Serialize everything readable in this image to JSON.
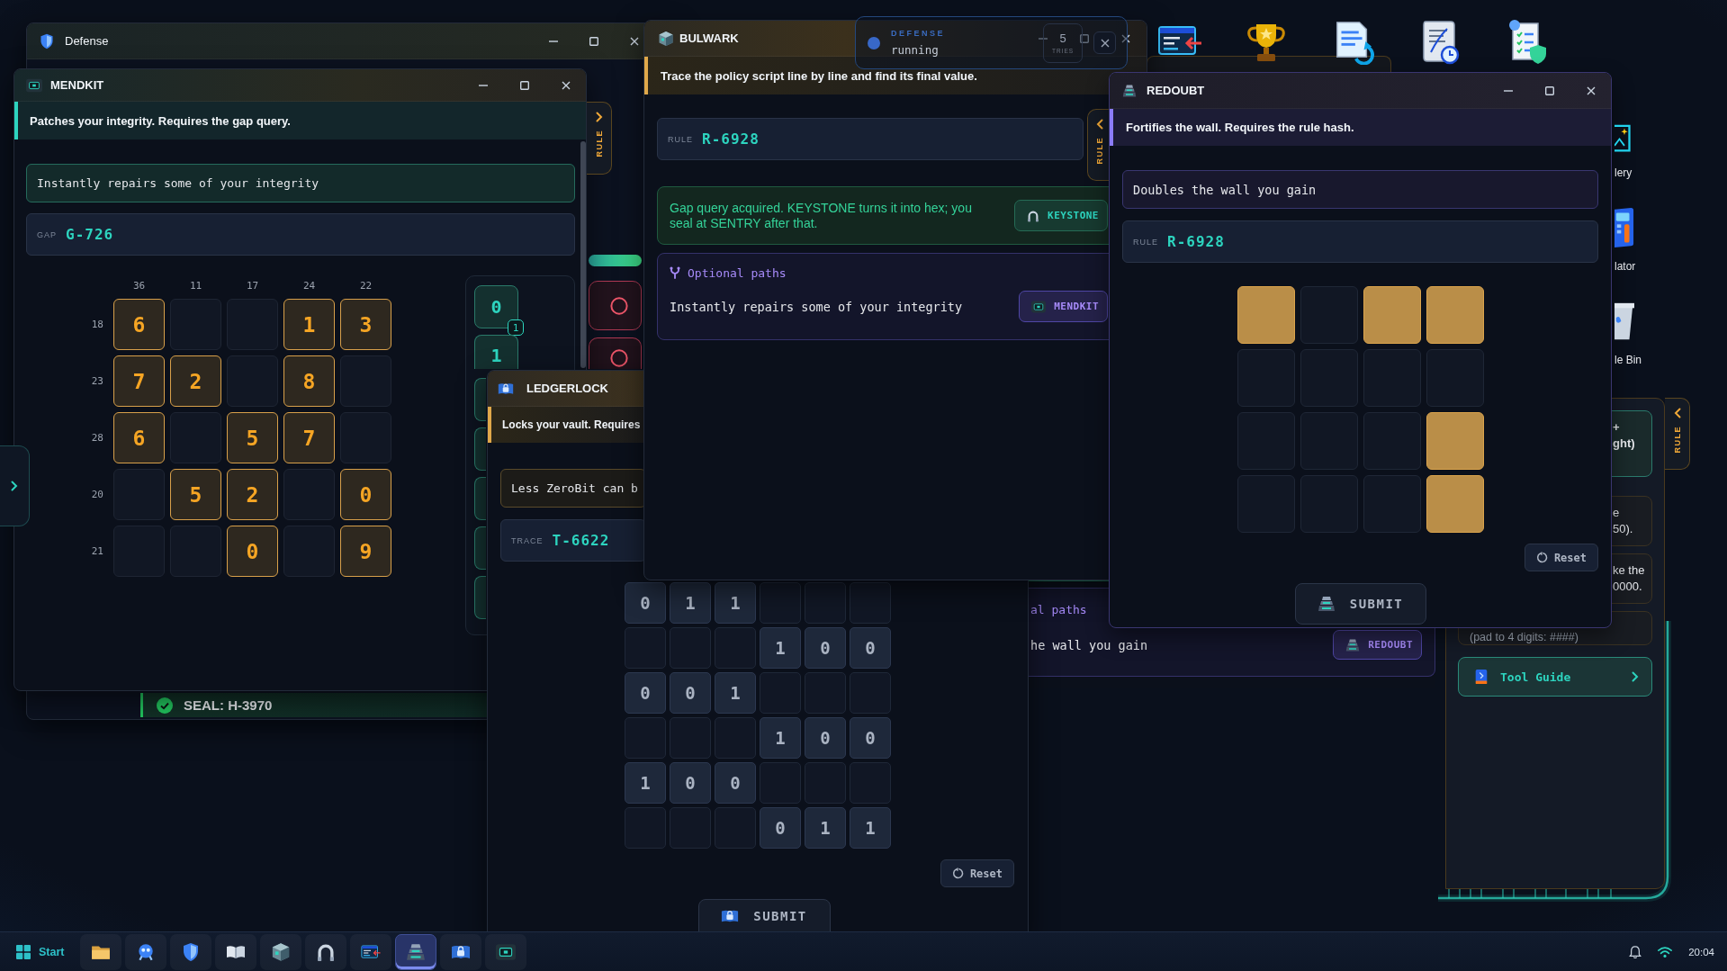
{
  "desktop": {
    "top_icons": [
      {
        "kind": "code"
      },
      {
        "kind": "trophy"
      },
      {
        "kind": "document"
      },
      {
        "kind": "scroll"
      },
      {
        "kind": "checklist"
      }
    ],
    "side_icons": [
      {
        "kind": "gallery",
        "label": "lery"
      },
      {
        "kind": "calculator",
        "label": "lator"
      },
      {
        "kind": "bin",
        "label": "le Bin"
      }
    ]
  },
  "defense": {
    "title": "Defense",
    "status_tiles": [
      {
        "kind": "ring"
      },
      {
        "kind": "ring"
      }
    ],
    "seal": "SEAL: H-3970"
  },
  "mendkit": {
    "title": "MENDKIT",
    "description": "Patches your integrity. Requires the gap query.",
    "effect": "Instantly repairs some of your integrity",
    "field": {
      "label": "GAP",
      "value": "G-726"
    },
    "grid": {
      "columns": [
        "36",
        "11",
        "17",
        "24",
        "22"
      ],
      "rows": [
        {
          "label": "18",
          "cells": [
            {
              "filled": true,
              "value": "6"
            },
            {
              "filled": false
            },
            {
              "filled": false
            },
            {
              "filled": true,
              "value": "1"
            },
            {
              "filled": true,
              "value": "3"
            }
          ]
        },
        {
          "label": "23",
          "cells": [
            {
              "filled": true,
              "value": "7"
            },
            {
              "filled": true,
              "value": "2"
            },
            {
              "filled": false
            },
            {
              "filled": true,
              "value": "8"
            },
            {
              "filled": false
            }
          ]
        },
        {
          "label": "28",
          "cells": [
            {
              "filled": true,
              "value": "6"
            },
            {
              "filled": false
            },
            {
              "filled": true,
              "value": "5"
            },
            {
              "filled": true,
              "value": "7"
            },
            {
              "filled": false
            }
          ]
        },
        {
          "label": "20",
          "cells": [
            {
              "filled": false
            },
            {
              "filled": true,
              "value": "5"
            },
            {
              "filled": true,
              "value": "2"
            },
            {
              "filled": false
            },
            {
              "filled": true,
              "value": "0"
            }
          ]
        },
        {
          "label": "21",
          "cells": [
            {
              "filled": false
            },
            {
              "filled": false
            },
            {
              "filled": true,
              "value": "0"
            },
            {
              "filled": false
            },
            {
              "filled": true,
              "value": "9"
            }
          ]
        }
      ]
    },
    "tiles": [
      {
        "kind": "number",
        "value": "0",
        "badge": "1"
      },
      {
        "kind": "number",
        "value": "1"
      },
      {
        "kind": "blank"
      },
      {
        "kind": "blank"
      },
      {
        "kind": "blank"
      },
      {
        "kind": "blank"
      },
      {
        "kind": "blank"
      }
    ],
    "side_tab": "RULE"
  },
  "ledgerlock": {
    "title": "LEDGERLOCK",
    "description": "Locks your vault. Requires",
    "effect": "Less ZeroBit can b",
    "field": {
      "label": "TRACE",
      "value": "T-6622"
    },
    "grid": [
      [
        {
          "filled": true,
          "value": "0"
        },
        {
          "filled": true,
          "value": "1"
        },
        {
          "filled": true,
          "value": "1"
        },
        {
          "filled": false
        },
        {
          "filled": false
        },
        {
          "filled": false
        }
      ],
      [
        {
          "filled": false
        },
        {
          "filled": false
        },
        {
          "filled": false
        },
        {
          "filled": true,
          "value": "1"
        },
        {
          "filled": true,
          "value": "0"
        },
        {
          "filled": true,
          "value": "0"
        }
      ],
      [
        {
          "filled": true,
          "value": "0"
        },
        {
          "filled": true,
          "value": "0"
        },
        {
          "filled": true,
          "value": "1"
        },
        {
          "filled": false
        },
        {
          "filled": false
        },
        {
          "filled": false
        }
      ],
      [
        {
          "filled": false
        },
        {
          "filled": false
        },
        {
          "filled": false
        },
        {
          "filled": true,
          "value": "1"
        },
        {
          "filled": true,
          "value": "0"
        },
        {
          "filled": true,
          "value": "0"
        }
      ],
      [
        {
          "filled": true,
          "value": "1"
        },
        {
          "filled": true,
          "value": "0"
        },
        {
          "filled": true,
          "value": "0"
        },
        {
          "filled": false
        },
        {
          "filled": false
        },
        {
          "filled": false
        }
      ],
      [
        {
          "filled": false
        },
        {
          "filled": false
        },
        {
          "filled": false
        },
        {
          "filled": true,
          "value": "0"
        },
        {
          "filled": true,
          "value": "1"
        },
        {
          "filled": true,
          "value": "1"
        }
      ]
    ],
    "reset": "Reset",
    "submit": "SUBMIT"
  },
  "bulwark": {
    "title": "BULWARK",
    "description": "Trace the policy script line by line and find its final value.",
    "field": {
      "label": "RULE",
      "value": "R-6928"
    },
    "side_tab": "RULE",
    "message": {
      "text": "Gap query acquired. KEYSTONE turns it into hex; you seal at SENTRY after that.",
      "button": "KEYSTONE"
    },
    "optional": {
      "heading": "Optional paths",
      "effect": "Instantly repairs some of your integrity",
      "button": "MENDKIT"
    }
  },
  "status_pill": {
    "label": "DEFENSE",
    "state": "running",
    "tries": "5",
    "tries_label": "TRIES"
  },
  "background_window": {
    "heading": "al paths",
    "effect": "he wall you gain",
    "button": "REDOUBT"
  },
  "redoubt": {
    "title": "REDOUBT",
    "description": "Fortifies the wall. Requires the rule hash.",
    "effect": "Doubles the wall you gain",
    "field": {
      "label": "RULE",
      "value": "R-6928"
    },
    "grid": [
      [
        {
          "filled": true
        },
        {
          "filled": false
        },
        {
          "filled": true
        },
        {
          "filled": true
        }
      ],
      [
        {
          "filled": false
        },
        {
          "filled": false
        },
        {
          "filled": false
        },
        {
          "filled": false
        }
      ],
      [
        {
          "filled": false
        },
        {
          "filled": false
        },
        {
          "filled": false
        },
        {
          "filled": true
        }
      ],
      [
        {
          "filled": false
        },
        {
          "filled": false
        },
        {
          "filled": false
        },
        {
          "filled": true
        }
      ]
    ],
    "reset": "Reset",
    "submit": "SUBMIT"
  },
  "side_panel": {
    "side_tab": "RULE",
    "cards": [
      {
        "kind": "highlight",
        "lines": [
          "+",
          "ght)"
        ]
      },
      {
        "kind": "note",
        "lines": [
          "e",
          "50)."
        ]
      },
      {
        "kind": "note",
        "lines": [
          "ke the",
          "0000."
        ]
      },
      {
        "kind": "hint",
        "lines": [
          "(pad to 4 digits: ####)"
        ]
      }
    ],
    "guide_button": "Tool Guide"
  },
  "taskbar": {
    "start": "Start",
    "apps": [
      {
        "kind": "folder",
        "selected": false
      },
      {
        "kind": "robot",
        "selected": false
      },
      {
        "kind": "shield",
        "selected": false
      },
      {
        "kind": "book",
        "selected": false
      },
      {
        "kind": "cube",
        "selected": false
      },
      {
        "kind": "arch",
        "selected": false
      },
      {
        "kind": "code",
        "selected": false
      },
      {
        "kind": "tower",
        "selected": true
      },
      {
        "kind": "ledger",
        "selected": false
      },
      {
        "kind": "chip",
        "selected": false
      }
    ],
    "time": "20:04"
  }
}
